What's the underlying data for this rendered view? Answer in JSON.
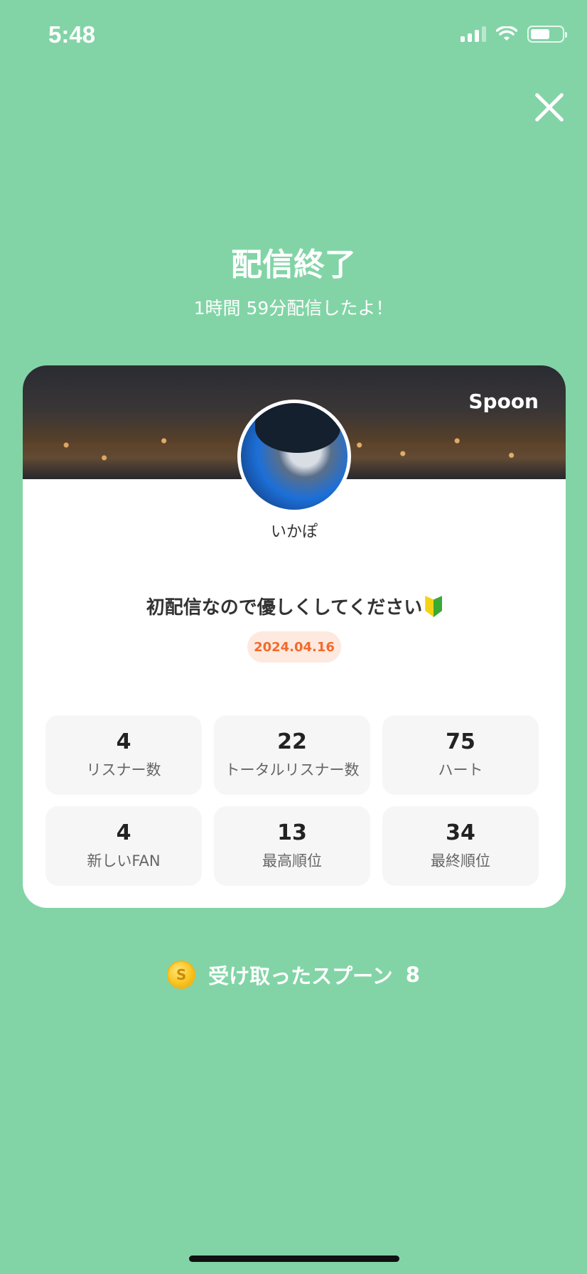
{
  "status_bar": {
    "time": "5:48"
  },
  "header": {
    "title": "配信終了",
    "subtitle": "1時間 59分配信したよ！"
  },
  "card": {
    "brand": "Spoon",
    "username": "いかぽ",
    "broadcast_title": "初配信なので優しくしてください",
    "date": "2024.04.16",
    "stats": [
      {
        "value": "4",
        "label": "リスナー数"
      },
      {
        "value": "22",
        "label": "トータルリスナー数"
      },
      {
        "value": "75",
        "label": "ハート"
      },
      {
        "value": "4",
        "label": "新しいFAN"
      },
      {
        "value": "13",
        "label": "最高順位"
      },
      {
        "value": "34",
        "label": "最終順位"
      }
    ]
  },
  "spoons": {
    "coin_symbol": "S",
    "label": "受け取ったスプーン",
    "count": "8"
  },
  "colors": {
    "background": "#82d4a6",
    "date_badge_bg": "#fde9df",
    "date_badge_text": "#f26a2c"
  }
}
